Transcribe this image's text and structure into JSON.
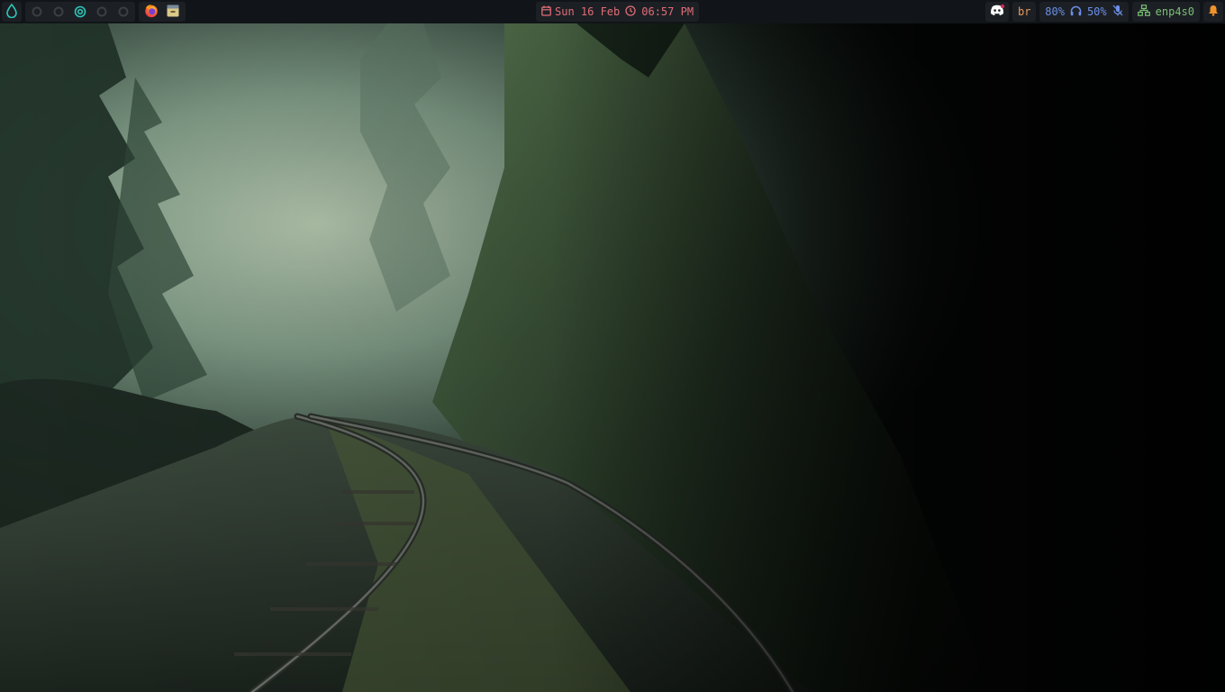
{
  "topbar": {
    "workspaces": [
      {
        "icon": "circle-outline-icon",
        "state": "inactive"
      },
      {
        "icon": "circle-outline-icon",
        "state": "inactive"
      },
      {
        "icon": "target-icon",
        "state": "active"
      },
      {
        "icon": "circle-outline-icon",
        "state": "inactive"
      },
      {
        "icon": "circle-outline-icon",
        "state": "inactive"
      }
    ],
    "launcher_icon": "droplet-icon",
    "apps": [
      {
        "name": "Firefox",
        "icon": "firefox-icon"
      },
      {
        "name": "Files",
        "icon": "file-manager-icon"
      }
    ],
    "clock": {
      "date": "Sun 16 Feb",
      "time": "06:57 PM"
    },
    "keyboard_layout": "br",
    "audio": {
      "output_volume": "80%",
      "input_volume": "50%",
      "mic_muted": true
    },
    "network": {
      "interface": "enp4s0"
    }
  },
  "colors": {
    "bar_bg": "#111418",
    "module_bg": "#1c2025",
    "accent_teal": "#2ec4b6",
    "clock": "#e06c75",
    "keyboard": "#e59a5b",
    "audio": "#6c8fe8",
    "network": "#7bbf75",
    "bell": "#f0932b"
  }
}
